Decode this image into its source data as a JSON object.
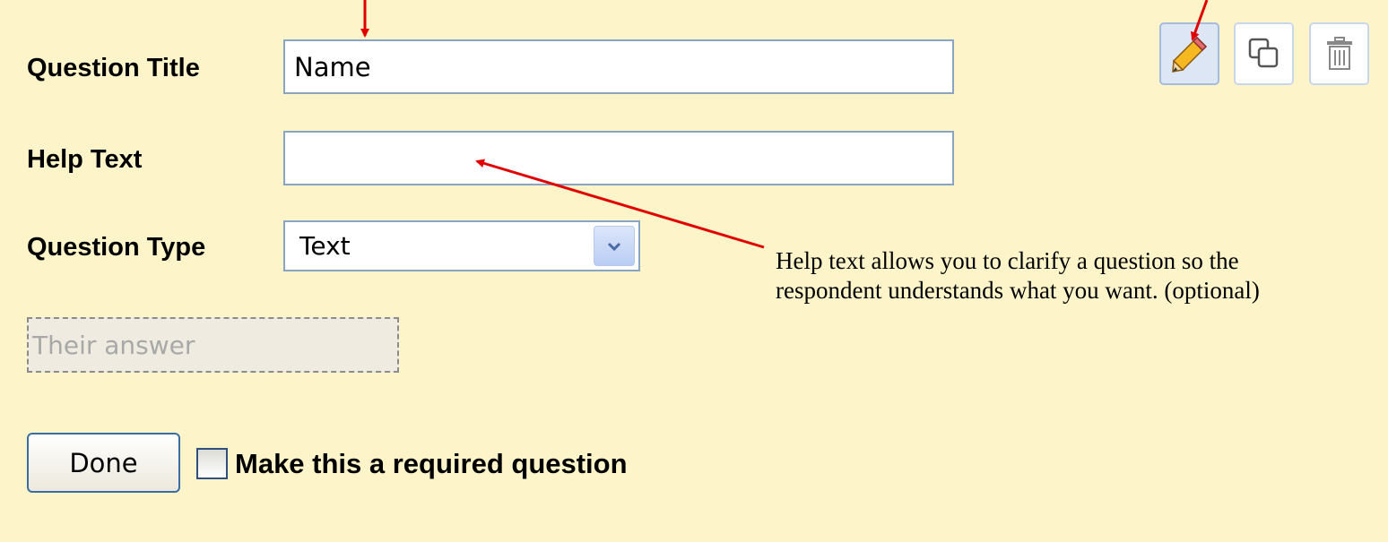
{
  "form": {
    "title_label": "Question Title",
    "title_value": "Name",
    "help_label": "Help Text",
    "help_value": "",
    "type_label": "Question Type",
    "type_value": "Text",
    "answer_placeholder": "Their answer",
    "done_label": "Done",
    "required_label": "Make this a required question",
    "required_checked": false
  },
  "toolbar": {
    "edit_icon": "pencil-icon",
    "duplicate_icon": "duplicate-icon",
    "delete_icon": "trash-icon"
  },
  "annotation": {
    "text": "Help text allows you to clarify a question so the respondent understands what you want. (optional)"
  },
  "colors": {
    "panel_background": "#fdf5c9",
    "input_border": "#8aa4c4",
    "arrow": "#e00000"
  }
}
